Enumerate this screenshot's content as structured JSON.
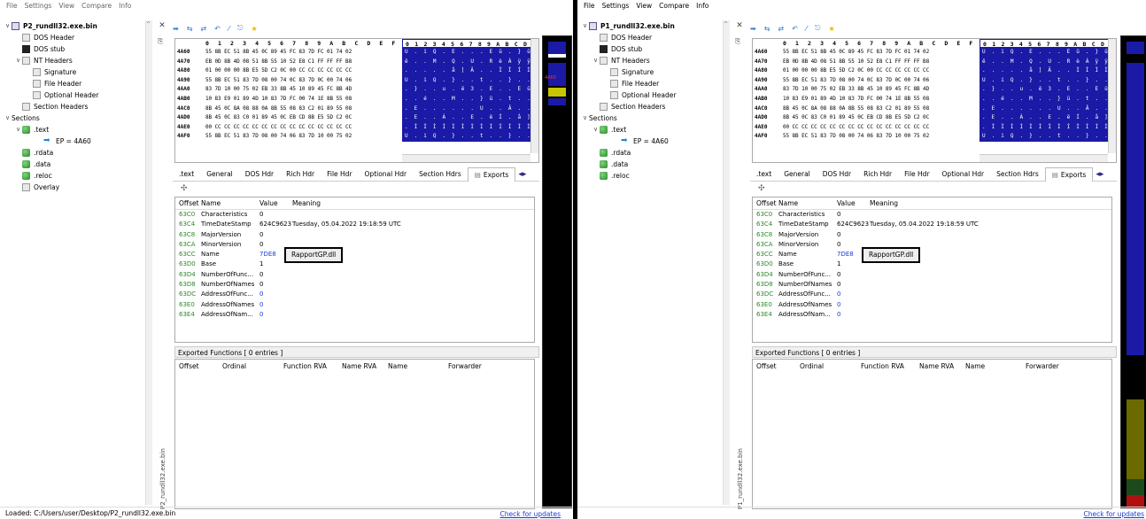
{
  "menu": [
    "File",
    "Settings",
    "View",
    "Compare",
    "Info"
  ],
  "hex": {
    "header_cols": "0 1 2 3 4 5 6 7 8 9 A B C D E F",
    "ascii_header": "0 1 2 3 4 5 6 7 8 9 A B C D",
    "rows": [
      {
        "off": "4A60",
        "bytes": "55 8B EC 51 8B 45 0C 89 45 FC 83 7D FC 01 74 02",
        "ascii": "U . i Q . E . . . E ü . } ü"
      },
      {
        "off": "4A70",
        "bytes": "EB 0D 8B 4D 08 51 8B 55 10 52 E8 C1 FF FF FF B8",
        "ascii": "ë . . M . Q . U . R è Á ÿ ÿ"
      },
      {
        "off": "4A80",
        "bytes": "01 00 00 00 8B E5 5D C2 0C 00 CC CC CC CC CC CC",
        "ascii": ". . . . . å ] Â . . Ì Ì Ì Ì"
      },
      {
        "off": "4A90",
        "bytes": "55 8B EC 51 83 7D 08 00 74 0C 83 7D 0C 00 74 06",
        "ascii": "U . i Q . } . . t . . } . ."
      },
      {
        "off": "4AA0",
        "bytes": "83 7D 10 00 75 02 EB 33 8B 45 10 89 45 FC 8B 4D",
        "ascii": ". } . . u . ë 3 . E . . E ü"
      },
      {
        "off": "4AB0",
        "bytes": "10 83 E9 01 89 4D 10 83 7D FC 00 74 1E 8B 55 08",
        "ascii": ". . é . . M . . } ü . t . ."
      },
      {
        "off": "4AC0",
        "bytes": "8B 45 0C 8A 08 88 0A 8B 55 08 83 C2 01 89 55 08",
        "ascii": ". E . . . . . . U . . Â . ."
      },
      {
        "off": "4AD0",
        "bytes": "8B 45 0C 83 C0 01 89 45 0C EB CD 8B E5 5D C2 0C",
        "ascii": ". E . . À . . E . ë Í . å ]"
      },
      {
        "off": "4AE0",
        "bytes": "00 CC CC CC CC CC CC CC CC CC CC CC CC CC CC CC",
        "ascii": ". Ì Ì Ì Ì Ì Ì Ì Ì Ì Ì Ì Ì Ì"
      },
      {
        "off": "4AF0",
        "bytes": "55 8B EC 51 83 7D 08 00 74 06 83 7D 10 00 75 02",
        "ascii": "U . i Q . } . . t . . } . ."
      }
    ]
  },
  "tabs": [
    ".text",
    "General",
    "DOS Hdr",
    "Rich Hdr",
    "File Hdr",
    "Optional Hdr",
    "Section Hdrs",
    "Exports"
  ],
  "grid_headers": {
    "offset": "Offset",
    "name": "Name",
    "value": "Value",
    "meaning": "Meaning"
  },
  "exports_rows": [
    {
      "offset": "63C0",
      "name": "Characteristics",
      "value": "0",
      "meaning": ""
    },
    {
      "offset": "63C4",
      "name": "TimeDateStamp",
      "value": "624C9623",
      "meaning": "Tuesday, 05.04.2022 19:18:59 UTC"
    },
    {
      "offset": "63C8",
      "name": "MajorVersion",
      "value": "0",
      "meaning": ""
    },
    {
      "offset": "63CA",
      "name": "MinorVersion",
      "value": "0",
      "meaning": ""
    },
    {
      "offset": "63CC",
      "name": "Name",
      "value": "7DE8",
      "meaning": "RapportGP.dll"
    },
    {
      "offset": "63D0",
      "name": "Base",
      "value": "1",
      "meaning": ""
    },
    {
      "offset": "63D4",
      "name": "NumberOfFunc...",
      "value": "0",
      "meaning": ""
    },
    {
      "offset": "63D8",
      "name": "NumberOfNames",
      "value": "0",
      "meaning": ""
    },
    {
      "offset": "63DC",
      "name": "AddressOfFunc...",
      "value": "0",
      "meaning": ""
    },
    {
      "offset": "63E0",
      "name": "AddressOfNames",
      "value": "0",
      "meaning": ""
    },
    {
      "offset": "63E4",
      "name": "AddressOfNam...",
      "value": "0",
      "meaning": ""
    }
  ],
  "exported_functions": {
    "title": "Exported Functions   [ 0 entries ]",
    "headers": [
      "Offset",
      "Ordinal",
      "Function RVA",
      "Name RVA",
      "Name",
      "Forwarder"
    ]
  },
  "left": {
    "file": "P2_rundll32.exe.bin",
    "tree": [
      {
        "label": "DOS Header",
        "indent": 1,
        "icon": "file"
      },
      {
        "label": "DOS stub",
        "indent": 1,
        "icon": "stub"
      },
      {
        "label": "NT Headers",
        "indent": 1,
        "icon": "file",
        "toggle": "∨"
      },
      {
        "label": "Signature",
        "indent": 2,
        "icon": "file"
      },
      {
        "label": "File Header",
        "indent": 2,
        "icon": "file"
      },
      {
        "label": "Optional Header",
        "indent": 2,
        "icon": "file"
      },
      {
        "label": "Section Headers",
        "indent": 1,
        "icon": "file"
      },
      {
        "label": "Sections",
        "indent": 0,
        "icon": "none",
        "toggle": "∨"
      },
      {
        "label": ".text",
        "indent": 1,
        "icon": "green",
        "toggle": "∨"
      },
      {
        "label": "EP = 4A60",
        "indent": 3,
        "icon": "arrow"
      },
      {
        "label": ".rdata",
        "indent": 1,
        "icon": "green"
      },
      {
        "label": ".data",
        "indent": 1,
        "icon": "green"
      },
      {
        "label": ".reloc",
        "indent": 1,
        "icon": "green"
      },
      {
        "label": "Overlay",
        "indent": 1,
        "icon": "file"
      }
    ],
    "side_label": "P2_rundll32.exe.bin",
    "status": "Loaded: C:/Users/user/Desktop/P2_rundll32.exe.bin",
    "updates": "Check for updates"
  },
  "right": {
    "file": "P1_rundll32.exe.bin",
    "tree": [
      {
        "label": "DOS Header",
        "indent": 1,
        "icon": "file"
      },
      {
        "label": "DOS stub",
        "indent": 1,
        "icon": "stub"
      },
      {
        "label": "NT Headers",
        "indent": 1,
        "icon": "file",
        "toggle": "∨"
      },
      {
        "label": "Signature",
        "indent": 2,
        "icon": "file"
      },
      {
        "label": "File Header",
        "indent": 2,
        "icon": "file"
      },
      {
        "label": "Optional Header",
        "indent": 2,
        "icon": "file"
      },
      {
        "label": "Section Headers",
        "indent": 1,
        "icon": "file"
      },
      {
        "label": "Sections",
        "indent": 0,
        "icon": "none",
        "toggle": "∨"
      },
      {
        "label": ".text",
        "indent": 1,
        "icon": "green",
        "toggle": "∨"
      },
      {
        "label": "EP = 4A60",
        "indent": 3,
        "icon": "arrow"
      },
      {
        "label": ".rdata",
        "indent": 1,
        "icon": "green"
      },
      {
        "label": ".data",
        "indent": 1,
        "icon": "green"
      },
      {
        "label": ".reloc",
        "indent": 1,
        "icon": "green"
      }
    ],
    "side_label": "P1_rundll32.exe.bin",
    "status": "",
    "updates": "Check for updates"
  },
  "colors": {
    "hex_ascii_bg": "#1a1aa6",
    "offset_green": "#2a8a2a",
    "value_blue": "#1e3ad5"
  },
  "icons": [
    "file-icon",
    "stub-icon",
    "section-icon",
    "entry-point-arrow-icon",
    "close-icon",
    "pin-icon",
    "star-icon"
  ]
}
